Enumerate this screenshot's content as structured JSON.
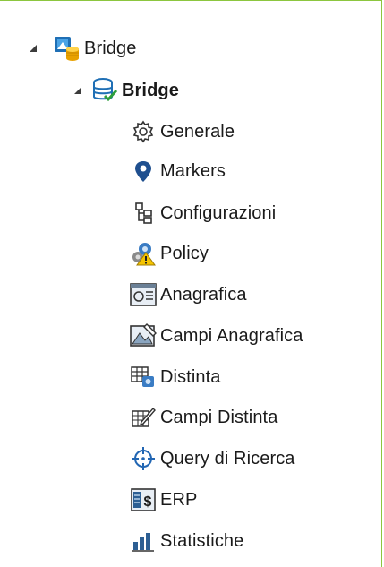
{
  "tree": {
    "root": {
      "label": "Bridge",
      "icon": "bridge-app-icon",
      "expanded": true
    },
    "child": {
      "label": "Bridge",
      "icon": "database-check-icon",
      "expanded": true
    },
    "items": [
      {
        "label": "Generale",
        "icon": "gear-icon"
      },
      {
        "label": "Markers",
        "icon": "map-pin-icon"
      },
      {
        "label": "Configurazioni",
        "icon": "flowchart-icon"
      },
      {
        "label": "Policy",
        "icon": "policy-warning-icon"
      },
      {
        "label": "Anagrafica",
        "icon": "anagrafica-icon"
      },
      {
        "label": "Campi Anagrafica",
        "icon": "campi-anagrafica-icon"
      },
      {
        "label": "Distinta",
        "icon": "distinta-icon"
      },
      {
        "label": "Campi Distinta",
        "icon": "campi-distinta-icon"
      },
      {
        "label": "Query di Ricerca",
        "icon": "crosshair-icon"
      },
      {
        "label": "ERP",
        "icon": "erp-icon"
      },
      {
        "label": "Statistiche",
        "icon": "bar-chart-icon"
      }
    ]
  },
  "colors": {
    "border": "#8cc63f",
    "accent_blue": "#1f6fb5"
  }
}
